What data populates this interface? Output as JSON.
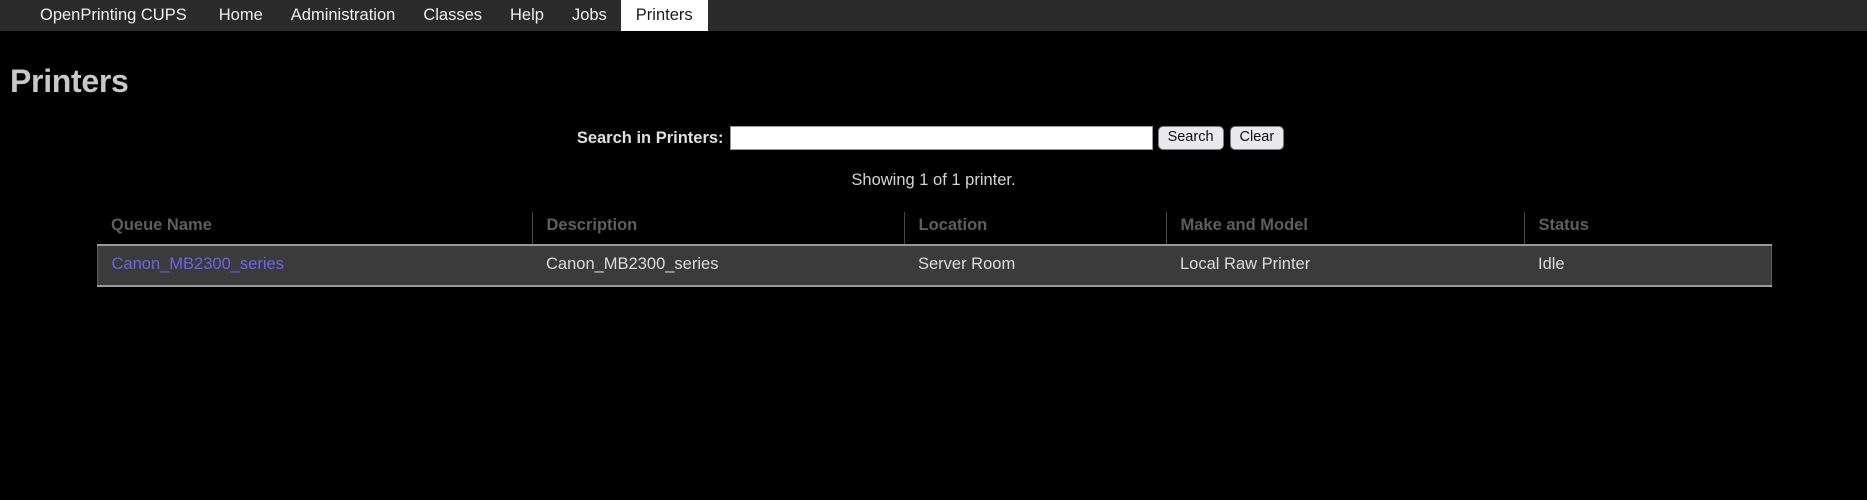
{
  "navbar": {
    "brand": "OpenPrinting CUPS",
    "items": [
      {
        "label": "Home",
        "active": false
      },
      {
        "label": "Administration",
        "active": false
      },
      {
        "label": "Classes",
        "active": false
      },
      {
        "label": "Help",
        "active": false
      },
      {
        "label": "Jobs",
        "active": false
      },
      {
        "label": "Printers",
        "active": true
      }
    ]
  },
  "page": {
    "title": "Printers"
  },
  "search": {
    "label": "Search in Printers:",
    "value": "",
    "placeholder": "",
    "search_button": "Search",
    "clear_button": "Clear"
  },
  "summary": {
    "showing": "Showing 1 of 1 printer."
  },
  "table": {
    "headers": [
      "Queue Name",
      "Description",
      "Location",
      "Make and Model",
      "Status"
    ],
    "rows": [
      {
        "queue_name": "Canon_MB2300_series",
        "description": "Canon_MB2300_series",
        "location": "Server Room",
        "make_and_model": "Local Raw Printer",
        "status": "Idle"
      }
    ]
  },
  "colors": {
    "page_background": "#000000",
    "navbar_background": "#2b2b2b",
    "active_tab_background": "#ffffff",
    "row_background": "#3b3b3b",
    "link": "#6b64e8",
    "header_text": "#5e5e5e"
  }
}
